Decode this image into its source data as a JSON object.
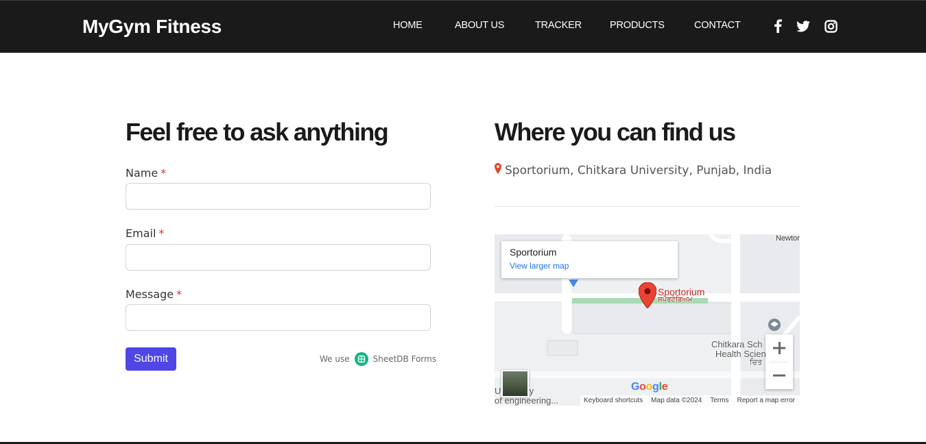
{
  "navbar": {
    "brand": "MyGym Fitness",
    "links": [
      "HOME",
      "ABOUT US",
      "TRACKER",
      "PRODUCTS",
      "CONTACT"
    ],
    "social_icons": [
      "facebook-icon",
      "twitter-icon",
      "instagram-icon"
    ]
  },
  "contact_form": {
    "heading": "Feel free to ask anything",
    "fields": [
      {
        "label": "Name",
        "required_mark": "*",
        "value": ""
      },
      {
        "label": "Email",
        "required_mark": "*",
        "value": ""
      },
      {
        "label": "Message",
        "required_mark": "*",
        "value": ""
      }
    ],
    "submit_label": "Submit",
    "powered_by_prefix": "We use",
    "powered_by_name": "SheetDB Forms"
  },
  "location": {
    "heading": "Where you can find us",
    "address": "Sportorium, Chitkara University, Punjab, India",
    "map": {
      "card_title": "Sportorium",
      "card_link": "View larger map",
      "pin_label": "Sportorium",
      "pin_label_local": "ਸਪੋਰਟੋਰਿਅਮ",
      "place_label_line1": "Chitkara Sch",
      "place_label_line2": "Health Scien",
      "place_label_local": "ਚਿਤ",
      "corner_label": "Newtor",
      "bottom_left_line1": "University",
      "bottom_left_line2": "of engineering...",
      "logo": "Google",
      "attribution": [
        "Keyboard shortcuts",
        "Map data ©2024",
        "Terms",
        "Report a map error"
      ]
    }
  },
  "colors": {
    "navbar_bg": "#1a1a1a",
    "submit_bg": "#4f46e5",
    "required_mark": "#d9342b",
    "pin": "#ea4335",
    "sheetdb_green": "#12b38a",
    "map_link": "#1a73e8"
  }
}
